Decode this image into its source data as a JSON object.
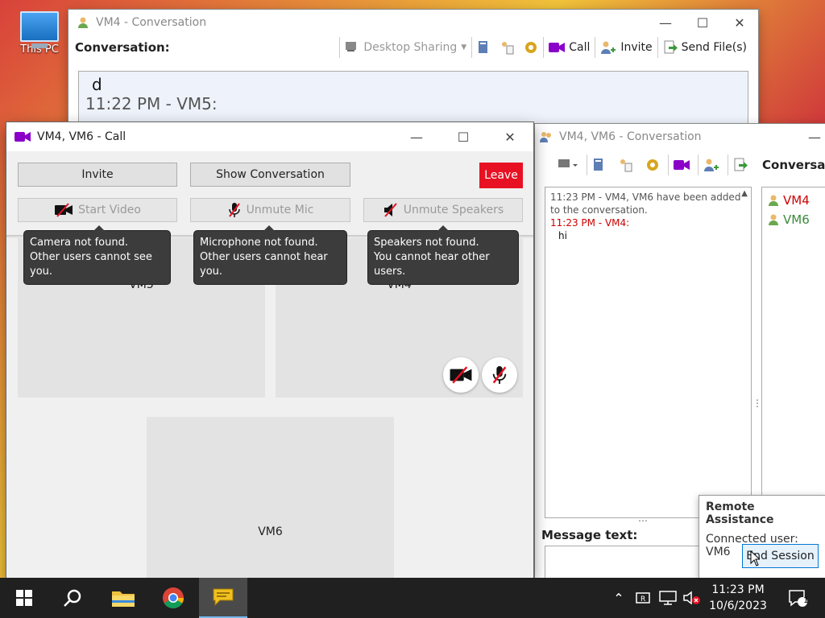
{
  "desktop": {
    "icon_label": "This PC"
  },
  "back_window": {
    "title": "VM4 - Conversation",
    "label": "Conversation:",
    "toolbar": {
      "desktop_sharing": "Desktop Sharing",
      "call": "Call",
      "invite": "Invite",
      "send_files": "Send File(s)"
    },
    "lines": [
      "d",
      "11:22 PM - VM5:"
    ]
  },
  "call_window": {
    "title": "VM4, VM6 - Call",
    "buttons": {
      "invite": "Invite",
      "show_conversation": "Show Conversation",
      "leave": "Leave",
      "start_video": "Start Video",
      "unmute_mic": "Unmute Mic",
      "unmute_speakers": "Unmute Speakers"
    },
    "tooltips": {
      "camera": [
        "Camera not found.",
        "Other users cannot see you."
      ],
      "mic": [
        "Microphone not found.",
        "Other users cannot hear you."
      ],
      "speakers": [
        "Speakers not found.",
        "You cannot hear other users."
      ]
    },
    "participants": [
      "VM5",
      "VM4",
      "VM6"
    ]
  },
  "right_window": {
    "title": "VM4, VM6 - Conversation",
    "participants_label": "Conversat",
    "log": [
      {
        "text": "11:23 PM - VM4, VM6 have been added to the conversation.",
        "style": "gray"
      },
      {
        "text": "11:23 PM - VM4:",
        "style": "red"
      },
      {
        "text": "hi",
        "style": "msg"
      }
    ],
    "participants": [
      "VM4",
      "VM6"
    ],
    "message_label": "Message text:"
  },
  "remote_assistance": {
    "title": "Remote Assistance",
    "status": "Connected user: VM6",
    "end_button": "End Session"
  },
  "taskbar": {
    "time": "11:23 PM",
    "date": "10/6/2023",
    "notifications": "1"
  },
  "colors": {
    "leave": "#e81123",
    "video_purple": "#8a00c8",
    "ms_orange": "#c96e14"
  }
}
